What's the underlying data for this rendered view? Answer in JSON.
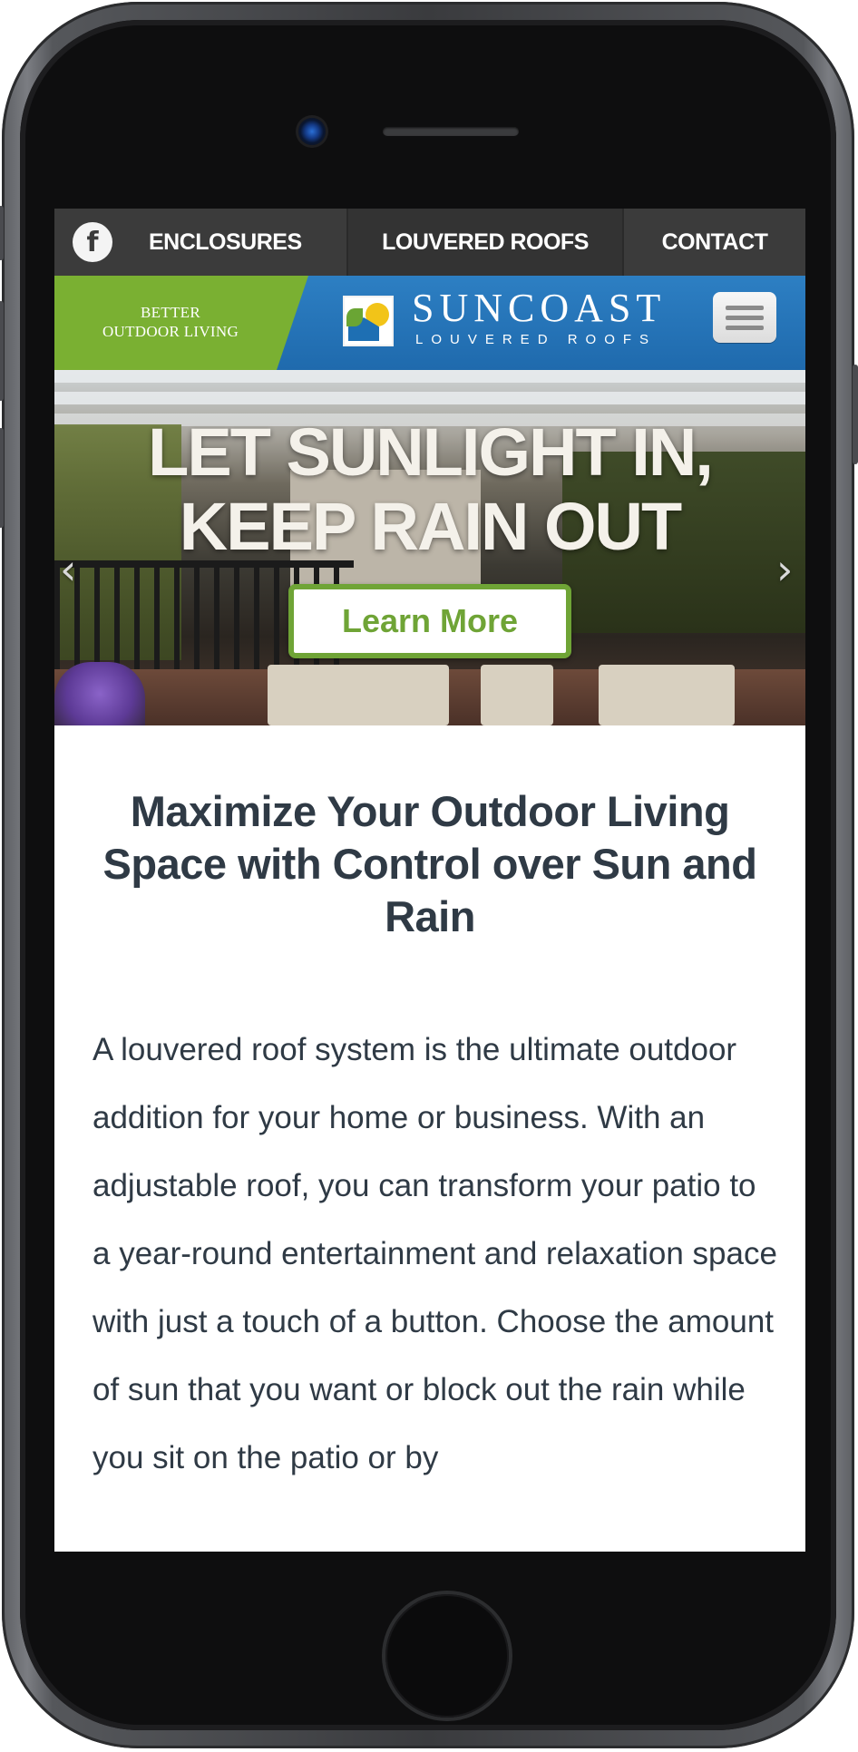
{
  "nav": {
    "facebook_icon": "facebook-icon",
    "enclosures": "ENCLOSURES",
    "louvered_roofs": "LOUVERED ROOFS",
    "contact": "CONTACT"
  },
  "header": {
    "tagline": "BETTER\nOUTDOOR LIVING",
    "logo_name": "SUNCOAST",
    "logo_sub": "LOUVERED ROOFS",
    "menu_icon": "hamburger-menu-icon"
  },
  "hero": {
    "headline": "LET SUNLIGHT IN,\nKEEP RAIN OUT",
    "button": "Learn More",
    "prev_icon": "chevron-left-icon",
    "next_icon": "chevron-right-icon"
  },
  "content": {
    "heading": "Maximize Your Outdoor Living Space with Control over Sun and Rain",
    "body": "A louvered roof system is the ultimate outdoor addition for your home or business. With an adjustable roof, you can transform your patio to a year-round entertainment and relaxation space with just a touch of a button. Choose the amount of sun that you want or block out the rain while you sit on the patio or by"
  },
  "colors": {
    "nav_bg": "#3b3b3b",
    "header_blue": "#1f6aad",
    "brand_green": "#7ab032",
    "button_green": "#6fa436",
    "text_dark": "#2f3a45"
  }
}
